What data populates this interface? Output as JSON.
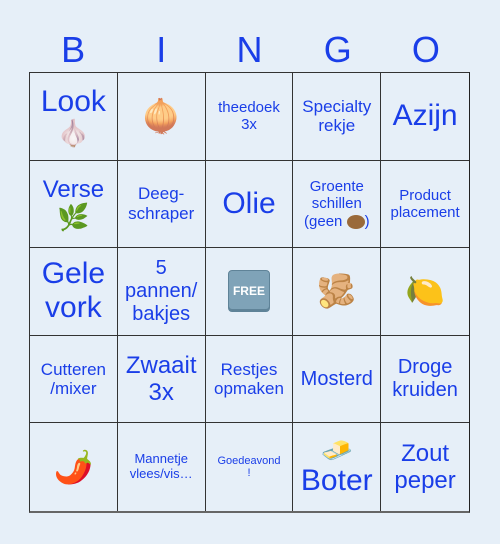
{
  "header": [
    "B",
    "I",
    "N",
    "G",
    "O"
  ],
  "cells": [
    {
      "text": "Look",
      "icon": "🧄",
      "icon_name": "garlic-icon"
    },
    {
      "text": "",
      "icon": "🧅",
      "icon_name": "onion-icon"
    },
    {
      "text": "theedoek\n3x"
    },
    {
      "text": "Specialty\nrekje"
    },
    {
      "text": "Azijn"
    },
    {
      "text": "Verse",
      "icon": "🌿",
      "icon_name": "herb-icon"
    },
    {
      "text": "Deeg-\nschraper"
    },
    {
      "text": "Olie"
    },
    {
      "text": "Groente\nschillen\n(geen",
      "suffix": ")",
      "inline_icon_name": "potato-icon"
    },
    {
      "text": "Product\nplacement"
    },
    {
      "text": "Gele\nvork"
    },
    {
      "text": "5\npannen/\nbakjes"
    },
    {
      "text": "",
      "free_label": "FREE",
      "icon_name": "free-icon"
    },
    {
      "text": "",
      "icon": "🫚",
      "icon_name": "ginger-icon"
    },
    {
      "text": "",
      "icon": "🍋",
      "icon_name": "lemon-icon"
    },
    {
      "text": "Cutteren\n/mixer"
    },
    {
      "text": "Zwaait\n3x"
    },
    {
      "text": "Restjes\nopmaken"
    },
    {
      "text": "Mosterd"
    },
    {
      "text": "Droge\nkruiden"
    },
    {
      "text": "",
      "icon": "🌶️",
      "icon_name": "chili-pepper-icon"
    },
    {
      "text": "Mannetje\nvlees/vis…"
    },
    {
      "text": "Goedeavond\n!"
    },
    {
      "text": "Boter",
      "icon": "🧈",
      "icon_name": "butter-icon",
      "icon_first": true
    },
    {
      "text": "Zout\npeper"
    }
  ]
}
